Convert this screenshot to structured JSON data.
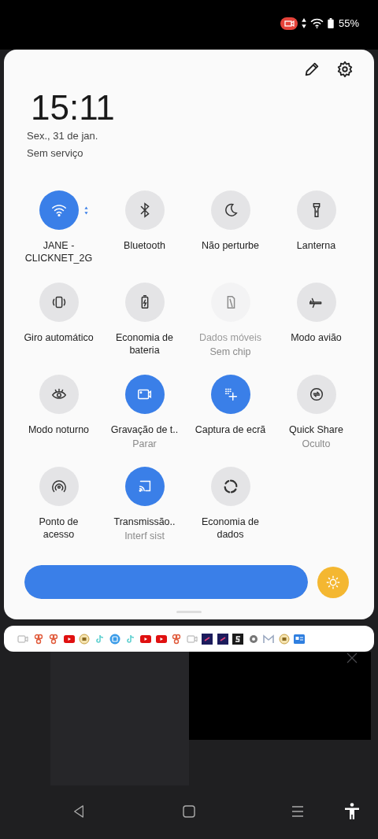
{
  "status_bar": {
    "battery": "55%"
  },
  "header": {
    "time": "15:11",
    "date": "Sex., 31 de jan.",
    "network": "Sem serviço"
  },
  "tiles": [
    {
      "label": "JANE - CLICKNET_2G",
      "on": true,
      "disabled": false
    },
    {
      "label": "Bluetooth",
      "on": false,
      "disabled": false
    },
    {
      "label": "Não perturbe",
      "on": false,
      "disabled": false
    },
    {
      "label": "Lanterna",
      "on": false,
      "disabled": false
    },
    {
      "label": "Giro automático",
      "on": false,
      "disabled": false
    },
    {
      "label": "Economia de bateria",
      "on": false,
      "disabled": false
    },
    {
      "label": "Dados móveis",
      "sublabel": "Sem chip",
      "on": false,
      "disabled": true
    },
    {
      "label": "Modo avião",
      "on": false,
      "disabled": false
    },
    {
      "label": "Modo noturno",
      "on": false,
      "disabled": false
    },
    {
      "label": "Gravação de t..",
      "sublabel": "Parar",
      "on": true,
      "disabled": false
    },
    {
      "label": "Captura de ecrã",
      "on": true,
      "disabled": false
    },
    {
      "label": "Quick Share",
      "sublabel": "Oculto",
      "on": false,
      "disabled": false
    },
    {
      "label": "Ponto de acesso",
      "on": false,
      "disabled": false
    },
    {
      "label": "Transmissão..",
      "sublabel": "Interf sist",
      "on": true,
      "disabled": false
    },
    {
      "label": "Economia de dados",
      "on": false,
      "disabled": false
    }
  ],
  "brightness": {
    "level": 1
  }
}
